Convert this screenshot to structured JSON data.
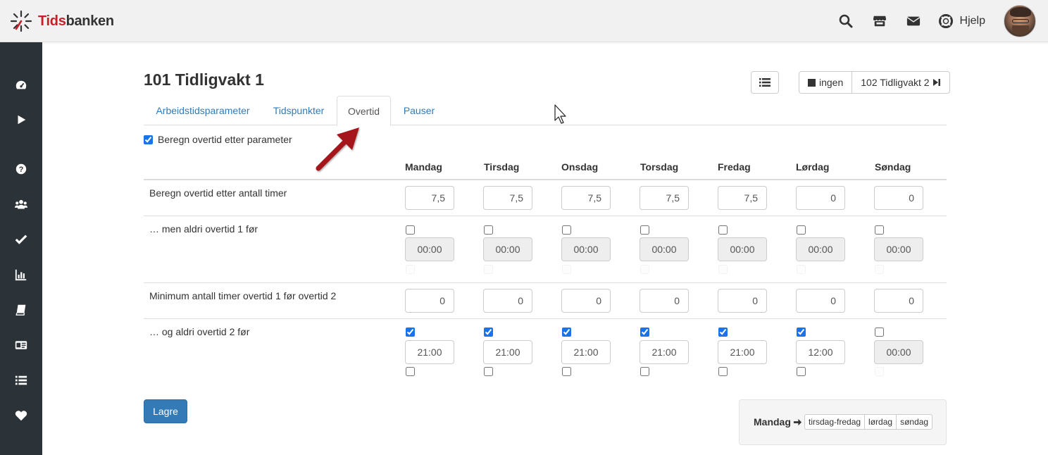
{
  "brand": {
    "name_part1": "Tids",
    "name_part2": "banken",
    "accent": "#c8202a"
  },
  "topbar": {
    "icons": [
      "search-icon",
      "store-icon",
      "envelope-icon",
      "lifebuoy-icon"
    ],
    "help_label": "Hjelp"
  },
  "sidebar": {
    "items": [
      "dashboard-icon",
      "play-icon",
      "question-icon",
      "users-icon",
      "check-icon",
      "bar-chart-icon",
      "book-icon",
      "id-card-icon",
      "list-icon",
      "heart-icon"
    ]
  },
  "page": {
    "title": "101 Tidligvakt 1",
    "prev_label": "ingen",
    "next_label": "102 Tidligvakt 2"
  },
  "tabs": [
    {
      "label": "Arbeidstidsparameter",
      "active": false
    },
    {
      "label": "Tidspunkter",
      "active": false
    },
    {
      "label": "Overtid",
      "active": true
    },
    {
      "label": "Pauser",
      "active": false
    }
  ],
  "calc_checkbox": {
    "label": "Beregn overtid etter parameter",
    "checked": true
  },
  "days": [
    "Mandag",
    "Tirsdag",
    "Onsdag",
    "Torsdag",
    "Fredag",
    "Lørdag",
    "Søndag"
  ],
  "rows": {
    "hours": {
      "label": "Beregn overtid etter antall timer",
      "values": [
        "7,5",
        "7,5",
        "7,5",
        "7,5",
        "7,5",
        "0",
        "0"
      ]
    },
    "never_ot1": {
      "label": "… men aldri overtid 1 før",
      "checked": [
        false,
        false,
        false,
        false,
        false,
        false,
        false
      ],
      "times": [
        "00:00",
        "00:00",
        "00:00",
        "00:00",
        "00:00",
        "00:00",
        "00:00"
      ]
    },
    "min_hours": {
      "label": "Minimum antall timer overtid 1 før overtid 2",
      "values": [
        "0",
        "0",
        "0",
        "0",
        "0",
        "0",
        "0"
      ]
    },
    "never_ot2": {
      "label": "… og aldri overtid 2 før",
      "checked": [
        true,
        true,
        true,
        true,
        true,
        true,
        false
      ],
      "times": [
        "21:00",
        "21:00",
        "21:00",
        "21:00",
        "21:00",
        "12:00",
        "00:00"
      ]
    }
  },
  "save_label": "Lagre",
  "copy": {
    "from_label": "Mandag",
    "targets": [
      "tirsdag-fredag",
      "lørdag",
      "søndag"
    ]
  }
}
